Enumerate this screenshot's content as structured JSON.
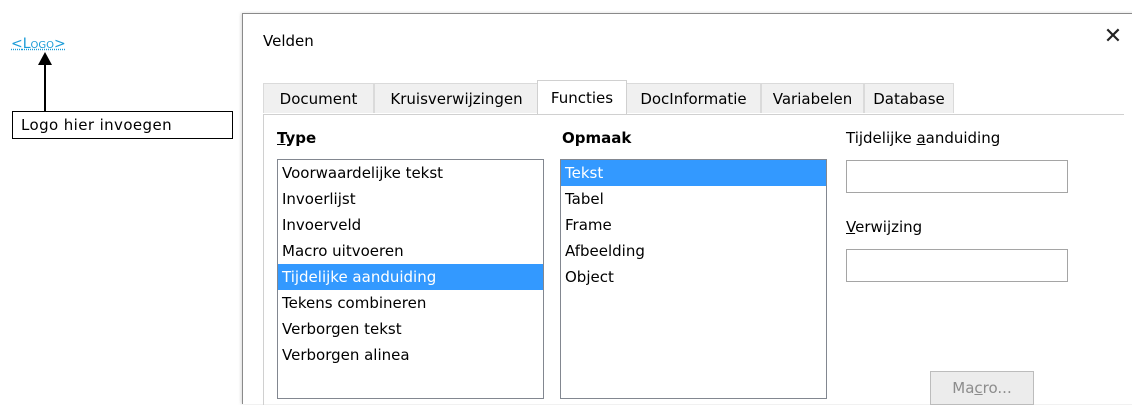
{
  "annotation": {
    "logo_field": {
      "open": "<",
      "text": "Logo",
      "close": ">"
    },
    "callout_text": "Logo hier invoegen"
  },
  "dialog": {
    "title": "Velden",
    "tabs": [
      {
        "label": "Document"
      },
      {
        "label": "Kruisverwijzingen"
      },
      {
        "label": "Functies",
        "active": true
      },
      {
        "label": "DocInformatie"
      },
      {
        "label": "Variabelen"
      },
      {
        "label": "Database"
      }
    ],
    "type": {
      "label_mnemonic": "T",
      "label_rest": "ype",
      "items": [
        "Voorwaardelijke tekst",
        "Invoerlijst",
        "Invoerveld",
        "Macro uitvoeren",
        "Tijdelijke aanduiding",
        "Tekens combineren",
        "Verborgen tekst",
        "Verborgen alinea"
      ],
      "selected_index": 4
    },
    "format": {
      "label": "Opmaak",
      "items": [
        "Tekst",
        "Tabel",
        "Frame",
        "Afbeelding",
        "Object"
      ],
      "selected_index": 0
    },
    "placeholder": {
      "label_prefix": "Tijdelijke ",
      "label_mnemonic": "a",
      "label_rest": "anduiding",
      "value": ""
    },
    "reference": {
      "label_mnemonic": "V",
      "label_rest": "erwijzing",
      "value": ""
    },
    "macro_button": {
      "prefix": "Ma",
      "mnemonic": "c",
      "rest": "ro..."
    }
  }
}
